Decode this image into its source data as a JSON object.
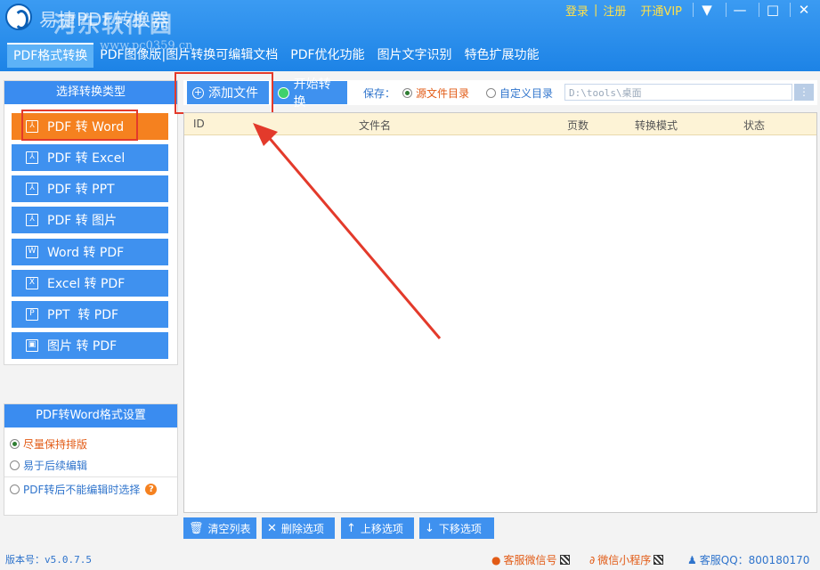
{
  "app": {
    "title": "易捷PDF转换器",
    "watermark": "河东软件园",
    "watermark_url": "www.pc0359.cn"
  },
  "top_links": {
    "login": "登录",
    "separator": "|",
    "register": "注册",
    "vip": "开通VIP"
  },
  "window_controls": {
    "menu": "▼",
    "minimize": "—",
    "maximize": "□",
    "close": "✕"
  },
  "nav": {
    "tabs": [
      {
        "label": "PDF格式转换"
      },
      {
        "label": "PDF图像版|图片转换可编辑文档"
      },
      {
        "label": "PDF优化功能"
      },
      {
        "label": "图片文字识别"
      },
      {
        "label": "特色扩展功能"
      }
    ]
  },
  "left_panel": {
    "header": "选择转换类型",
    "items": [
      {
        "label": "PDF 转 Word",
        "icon": "pdf-icon"
      },
      {
        "label": "PDF 转 Excel",
        "icon": "pdf-icon"
      },
      {
        "label": "PDF 转 PPT",
        "icon": "pdf-icon"
      },
      {
        "label": "PDF 转 图片",
        "icon": "pdf-icon"
      },
      {
        "label": "Word 转 PDF",
        "icon": "word-icon"
      },
      {
        "label": "Excel 转 PDF",
        "icon": "excel-icon"
      },
      {
        "label": "PPT  转 PDF",
        "icon": "ppt-icon"
      },
      {
        "label": "图片 转 PDF",
        "icon": "image-icon"
      }
    ]
  },
  "settings": {
    "header": "PDF转Word格式设置",
    "options": [
      {
        "label": "尽量保持排版",
        "selected": true
      },
      {
        "label": "易于后续编辑",
        "selected": false
      },
      {
        "label": "PDF转后不能编辑时选择",
        "selected": false
      }
    ]
  },
  "toolbar": {
    "add_file": "添加文件",
    "start_convert": "开始转换",
    "save_label": "保存：",
    "save_source": "源文件目录",
    "save_custom": "自定义目录",
    "path_value": "D:\\tools\\桌面",
    "path_button": "⋮"
  },
  "table": {
    "columns": [
      "ID",
      "文件名",
      "页数",
      "转换模式",
      "状态"
    ],
    "header_bg": "#fdf3d6"
  },
  "bottom_buttons": {
    "clear": "清空列表",
    "delete": "删除选项",
    "move_up": "上移选项",
    "move_down": "下移选项"
  },
  "status": {
    "version": "版本号：v5.0.7.5",
    "wechat_service": "客服微信号",
    "mini_program": "微信小程序",
    "qq_service": "客服QQ：800180170"
  },
  "colors": {
    "accent_blue": "#3f91ef",
    "active_orange": "#f5811f",
    "highlight_red": "#e33a2b"
  }
}
